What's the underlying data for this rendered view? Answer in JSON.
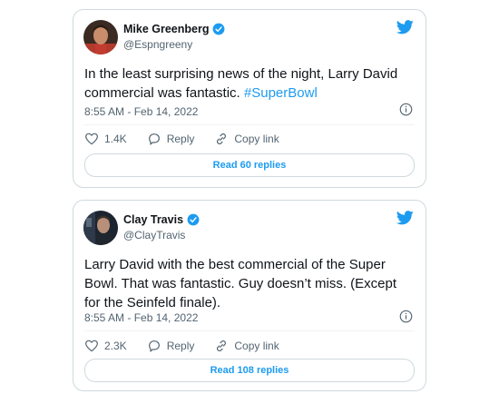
{
  "colors": {
    "accent": "#1d9bf0",
    "text": "#0f1419",
    "muted": "#536471",
    "border": "#cfd9de"
  },
  "tweets": [
    {
      "display_name": "Mike Greenberg",
      "handle": "@Espngreeny",
      "verified": true,
      "text_before": "In the least surprising news of the night, Larry David commercial was fantastic. ",
      "hashtag": "#SuperBowl",
      "timestamp": "8:55 AM - Feb 14, 2022",
      "likes": "1.4K",
      "reply_label": "Reply",
      "copy_link_label": "Copy link",
      "replies_button": "Read 60 replies",
      "icons": [
        "verified-badge-icon",
        "twitter-bird-icon",
        "info-icon",
        "heart-icon",
        "reply-bubble-icon",
        "link-icon"
      ]
    },
    {
      "display_name": "Clay Travis",
      "handle": "@ClayTravis",
      "verified": true,
      "text_before": "Larry David with the best commercial of the Super Bowl. That was fantastic. Guy doesn’t miss. (Except for the Seinfeld finale).",
      "hashtag": "",
      "timestamp": "8:55 AM - Feb 14, 2022",
      "likes": "2.3K",
      "reply_label": "Reply",
      "copy_link_label": "Copy link",
      "replies_button": "Read 108 replies",
      "icons": [
        "verified-badge-icon",
        "twitter-bird-icon",
        "info-icon",
        "heart-icon",
        "reply-bubble-icon",
        "link-icon"
      ]
    }
  ]
}
